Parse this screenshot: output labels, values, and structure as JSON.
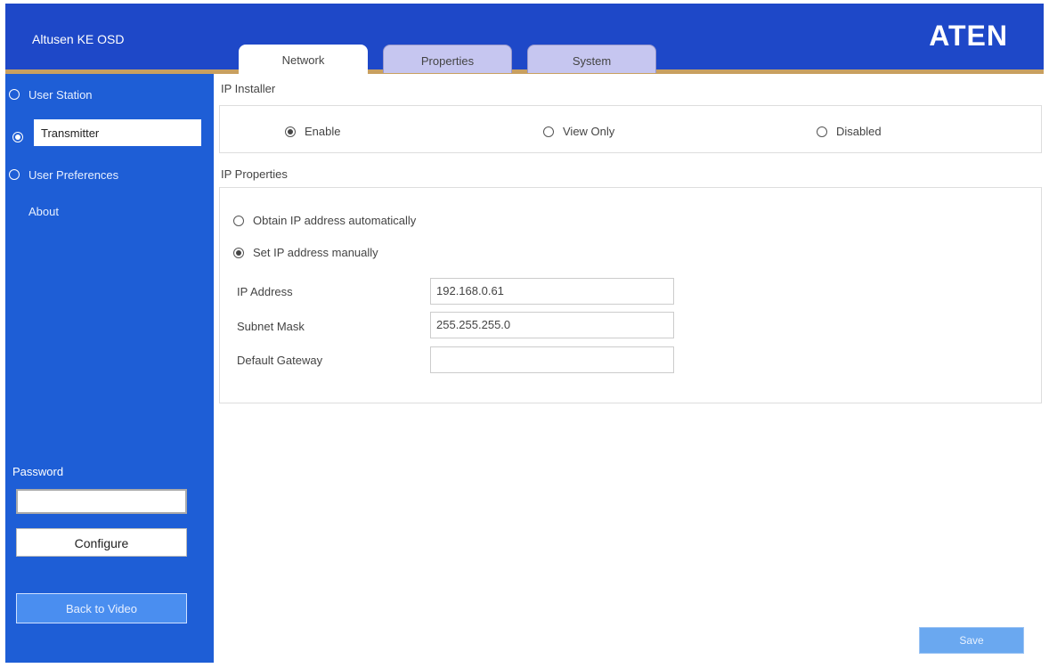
{
  "header": {
    "app_title": "Altusen KE OSD",
    "logo": "ATEN"
  },
  "tabs": [
    {
      "label": "Network",
      "active": true
    },
    {
      "label": "Properties",
      "active": false
    },
    {
      "label": "System",
      "active": false
    }
  ],
  "sidebar": {
    "items": [
      {
        "label": "User Station",
        "selected": false
      },
      {
        "label": "Transmitter",
        "selected": true
      },
      {
        "label": "User Preferences",
        "selected": false
      },
      {
        "label": "About",
        "selected": false
      }
    ],
    "password_label": "Password",
    "password_value": "",
    "configure_label": "Configure",
    "back_label": "Back to Video"
  },
  "ip_installer": {
    "label": "IP Installer",
    "options": [
      {
        "label": "Enable",
        "selected": true
      },
      {
        "label": "View Only",
        "selected": false
      },
      {
        "label": "Disabled",
        "selected": false
      }
    ]
  },
  "ip_properties": {
    "label": "IP Properties",
    "modes": [
      {
        "label": "Obtain IP address automatically",
        "selected": false
      },
      {
        "label": "Set IP address manually",
        "selected": true
      }
    ],
    "fields": [
      {
        "label": "IP Address",
        "value": "192.168.0.61"
      },
      {
        "label": "Subnet Mask",
        "value": "255.255.255.0"
      },
      {
        "label": "Default Gateway",
        "value": ""
      }
    ]
  },
  "save_label": "Save",
  "colors": {
    "header": "#1e48c8",
    "sidebar": "#1e5ed6",
    "tab_inactive": "#c6c6f0",
    "save_button": "#6aa8f0"
  }
}
